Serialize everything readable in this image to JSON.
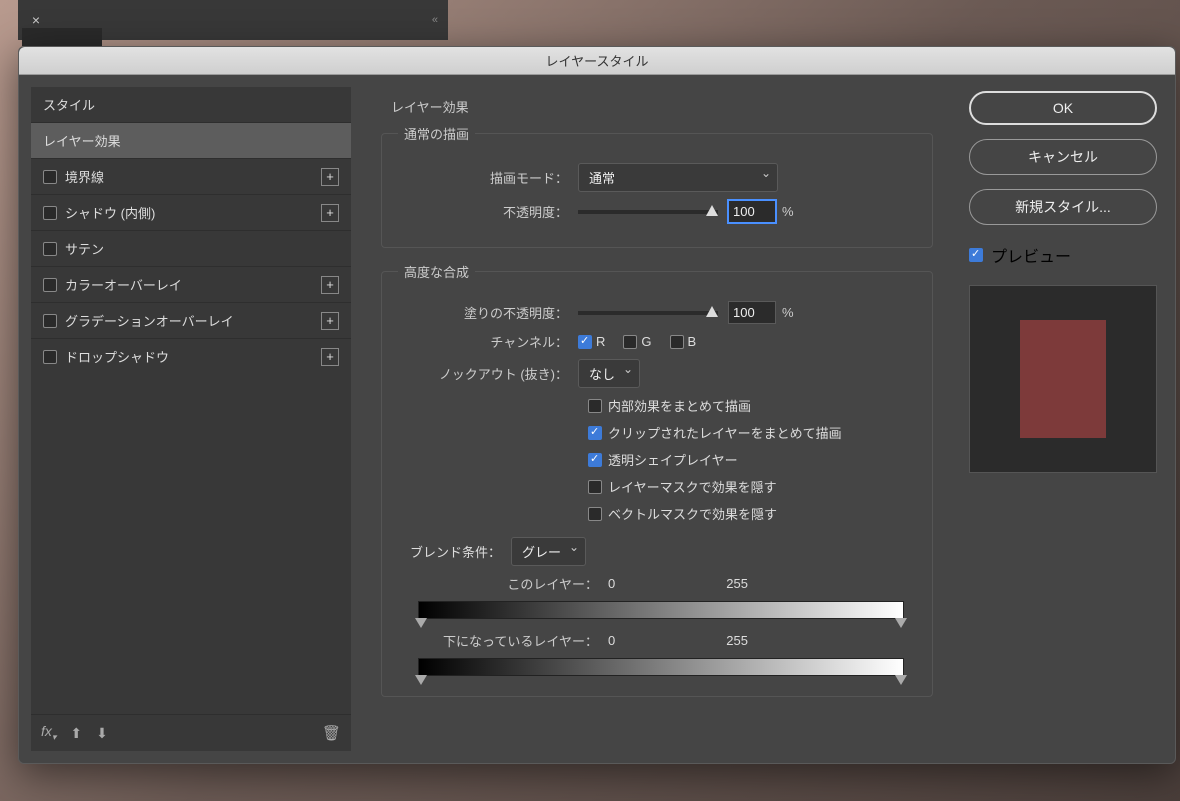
{
  "dialog_title": "レイヤースタイル",
  "sidebar_header": "スタイル",
  "styles": [
    {
      "id": "blending",
      "label": "レイヤー効果",
      "checked": null,
      "addable": false,
      "selected": true
    },
    {
      "id": "stroke",
      "label": "境界線",
      "checked": false,
      "addable": true
    },
    {
      "id": "inner-shadow",
      "label": "シャドウ (内側)",
      "checked": false,
      "addable": true
    },
    {
      "id": "satin",
      "label": "サテン",
      "checked": false,
      "addable": false
    },
    {
      "id": "color-overlay",
      "label": "カラーオーバーレイ",
      "checked": false,
      "addable": true
    },
    {
      "id": "gradient-overlay",
      "label": "グラデーションオーバーレイ",
      "checked": false,
      "addable": true
    },
    {
      "id": "drop-shadow",
      "label": "ドロップシャドウ",
      "checked": false,
      "addable": true
    }
  ],
  "settings": {
    "title": "レイヤー効果",
    "general_group": "通常の描画",
    "blend_mode_label": "描画モード：",
    "blend_mode_value": "通常",
    "opacity_label": "不透明度：",
    "opacity_value": "100",
    "pct": "%",
    "advanced_group": "高度な合成",
    "fill_opacity_label": "塗りの不透明度：",
    "fill_opacity_value": "100",
    "channels_label": "チャンネル：",
    "ch_r": "R",
    "ch_g": "G",
    "ch_b": "B",
    "knockout_label": "ノックアウト (抜き)：",
    "knockout_value": "なし",
    "opt1": "内部効果をまとめて描画",
    "opt2": "クリップされたレイヤーをまとめて描画",
    "opt3": "透明シェイプレイヤー",
    "opt4": "レイヤーマスクで効果を隠す",
    "opt5": "ベクトルマスクで効果を隠す",
    "blend_if_label": "ブレンド条件：",
    "blend_if_value": "グレー",
    "this_layer_label": "このレイヤー：",
    "this_low": "0",
    "this_high": "255",
    "under_layer_label": "下になっているレイヤー：",
    "under_low": "0",
    "under_high": "255"
  },
  "buttons": {
    "ok": "OK",
    "cancel": "キャンセル",
    "new_style": "新規スタイル..."
  },
  "preview_label": "プレビュー",
  "swatch_color": "#7d3a3a"
}
